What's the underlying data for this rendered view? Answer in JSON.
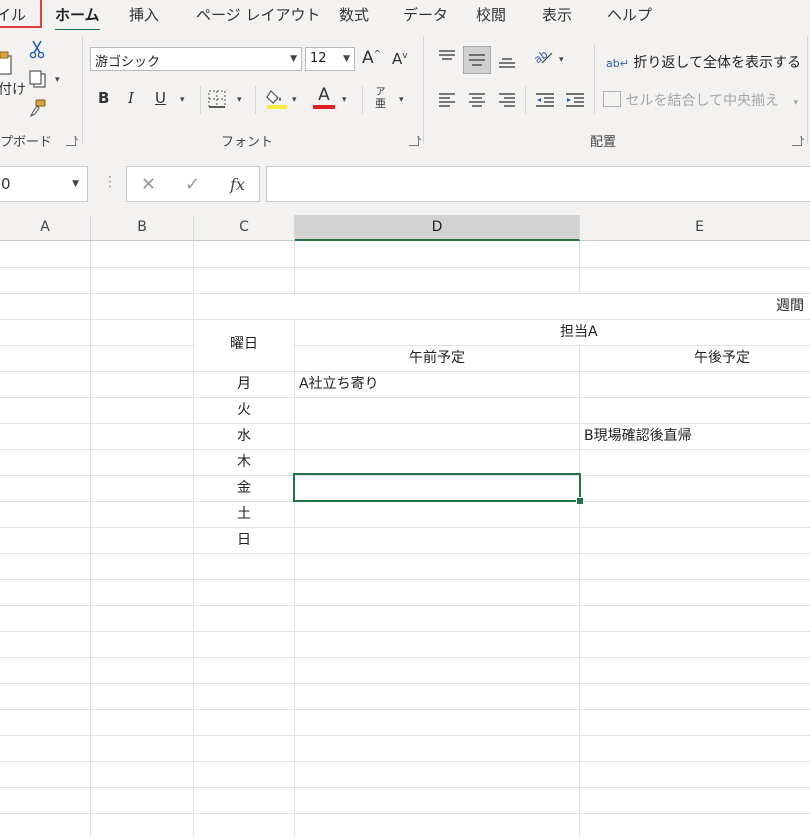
{
  "ribbon_tabs": {
    "file": "イル",
    "home": "ホーム",
    "insert": "挿入",
    "page_layout": "ページ レイアウト",
    "formulas": "数式",
    "data": "データ",
    "review": "校閲",
    "view": "表示",
    "help": "ヘルプ"
  },
  "clipboard": {
    "paste_label": "付け",
    "group_label": "プボード"
  },
  "font_group": {
    "font_name": "游ゴシック",
    "font_size": "12",
    "grow": "A",
    "shrink": "A",
    "bold": "B",
    "italic": "I",
    "underline": "U",
    "font_color": "A",
    "phonetic": "ア",
    "group_label": "フォント"
  },
  "alignment_group": {
    "wrap_text": "折り返して全体を表示する",
    "merge_center": "セルを結合して中央揃え",
    "group_label": "配置"
  },
  "formula_bar": {
    "name_box": "0",
    "fx": "fx",
    "cancel": "✕",
    "enter": "✓",
    "value": ""
  },
  "columns": [
    "A",
    "B",
    "C",
    "D",
    "E"
  ],
  "sheet": {
    "title_partial": "週間",
    "day_header": "曜日",
    "person": "担当A",
    "am_header": "午前予定",
    "pm_header": "午後予定",
    "days": [
      "月",
      "火",
      "水",
      "木",
      "金",
      "土",
      "日"
    ],
    "am": [
      "A社立ち寄り",
      "",
      "",
      "",
      "",
      "",
      ""
    ],
    "pm": [
      "",
      "",
      "B現場確認後直帰",
      "",
      "",
      "",
      ""
    ]
  },
  "colors": {
    "accent_green": "#217346",
    "file_outline": "#e0403a",
    "highlight_yellow": "#ffeb3b",
    "font_red": "#e02020"
  }
}
